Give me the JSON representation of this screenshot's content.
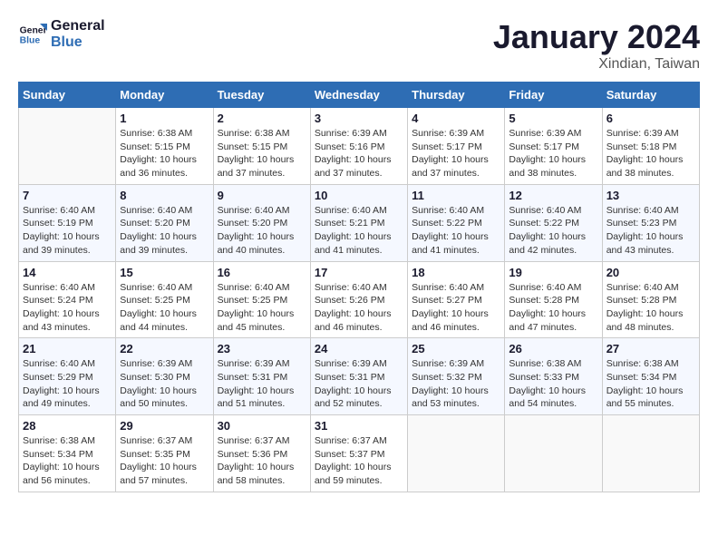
{
  "header": {
    "logo_line1": "General",
    "logo_line2": "Blue",
    "month_title": "January 2024",
    "location": "Xindian, Taiwan"
  },
  "weekdays": [
    "Sunday",
    "Monday",
    "Tuesday",
    "Wednesday",
    "Thursday",
    "Friday",
    "Saturday"
  ],
  "weeks": [
    [
      {
        "day": "",
        "sunrise": "",
        "sunset": "",
        "daylight": ""
      },
      {
        "day": "1",
        "sunrise": "Sunrise: 6:38 AM",
        "sunset": "Sunset: 5:15 PM",
        "daylight": "Daylight: 10 hours and 36 minutes."
      },
      {
        "day": "2",
        "sunrise": "Sunrise: 6:38 AM",
        "sunset": "Sunset: 5:15 PM",
        "daylight": "Daylight: 10 hours and 37 minutes."
      },
      {
        "day": "3",
        "sunrise": "Sunrise: 6:39 AM",
        "sunset": "Sunset: 5:16 PM",
        "daylight": "Daylight: 10 hours and 37 minutes."
      },
      {
        "day": "4",
        "sunrise": "Sunrise: 6:39 AM",
        "sunset": "Sunset: 5:17 PM",
        "daylight": "Daylight: 10 hours and 37 minutes."
      },
      {
        "day": "5",
        "sunrise": "Sunrise: 6:39 AM",
        "sunset": "Sunset: 5:17 PM",
        "daylight": "Daylight: 10 hours and 38 minutes."
      },
      {
        "day": "6",
        "sunrise": "Sunrise: 6:39 AM",
        "sunset": "Sunset: 5:18 PM",
        "daylight": "Daylight: 10 hours and 38 minutes."
      }
    ],
    [
      {
        "day": "7",
        "sunrise": "Sunrise: 6:40 AM",
        "sunset": "Sunset: 5:19 PM",
        "daylight": "Daylight: 10 hours and 39 minutes."
      },
      {
        "day": "8",
        "sunrise": "Sunrise: 6:40 AM",
        "sunset": "Sunset: 5:20 PM",
        "daylight": "Daylight: 10 hours and 39 minutes."
      },
      {
        "day": "9",
        "sunrise": "Sunrise: 6:40 AM",
        "sunset": "Sunset: 5:20 PM",
        "daylight": "Daylight: 10 hours and 40 minutes."
      },
      {
        "day": "10",
        "sunrise": "Sunrise: 6:40 AM",
        "sunset": "Sunset: 5:21 PM",
        "daylight": "Daylight: 10 hours and 41 minutes."
      },
      {
        "day": "11",
        "sunrise": "Sunrise: 6:40 AM",
        "sunset": "Sunset: 5:22 PM",
        "daylight": "Daylight: 10 hours and 41 minutes."
      },
      {
        "day": "12",
        "sunrise": "Sunrise: 6:40 AM",
        "sunset": "Sunset: 5:22 PM",
        "daylight": "Daylight: 10 hours and 42 minutes."
      },
      {
        "day": "13",
        "sunrise": "Sunrise: 6:40 AM",
        "sunset": "Sunset: 5:23 PM",
        "daylight": "Daylight: 10 hours and 43 minutes."
      }
    ],
    [
      {
        "day": "14",
        "sunrise": "Sunrise: 6:40 AM",
        "sunset": "Sunset: 5:24 PM",
        "daylight": "Daylight: 10 hours and 43 minutes."
      },
      {
        "day": "15",
        "sunrise": "Sunrise: 6:40 AM",
        "sunset": "Sunset: 5:25 PM",
        "daylight": "Daylight: 10 hours and 44 minutes."
      },
      {
        "day": "16",
        "sunrise": "Sunrise: 6:40 AM",
        "sunset": "Sunset: 5:25 PM",
        "daylight": "Daylight: 10 hours and 45 minutes."
      },
      {
        "day": "17",
        "sunrise": "Sunrise: 6:40 AM",
        "sunset": "Sunset: 5:26 PM",
        "daylight": "Daylight: 10 hours and 46 minutes."
      },
      {
        "day": "18",
        "sunrise": "Sunrise: 6:40 AM",
        "sunset": "Sunset: 5:27 PM",
        "daylight": "Daylight: 10 hours and 46 minutes."
      },
      {
        "day": "19",
        "sunrise": "Sunrise: 6:40 AM",
        "sunset": "Sunset: 5:28 PM",
        "daylight": "Daylight: 10 hours and 47 minutes."
      },
      {
        "day": "20",
        "sunrise": "Sunrise: 6:40 AM",
        "sunset": "Sunset: 5:28 PM",
        "daylight": "Daylight: 10 hours and 48 minutes."
      }
    ],
    [
      {
        "day": "21",
        "sunrise": "Sunrise: 6:40 AM",
        "sunset": "Sunset: 5:29 PM",
        "daylight": "Daylight: 10 hours and 49 minutes."
      },
      {
        "day": "22",
        "sunrise": "Sunrise: 6:39 AM",
        "sunset": "Sunset: 5:30 PM",
        "daylight": "Daylight: 10 hours and 50 minutes."
      },
      {
        "day": "23",
        "sunrise": "Sunrise: 6:39 AM",
        "sunset": "Sunset: 5:31 PM",
        "daylight": "Daylight: 10 hours and 51 minutes."
      },
      {
        "day": "24",
        "sunrise": "Sunrise: 6:39 AM",
        "sunset": "Sunset: 5:31 PM",
        "daylight": "Daylight: 10 hours and 52 minutes."
      },
      {
        "day": "25",
        "sunrise": "Sunrise: 6:39 AM",
        "sunset": "Sunset: 5:32 PM",
        "daylight": "Daylight: 10 hours and 53 minutes."
      },
      {
        "day": "26",
        "sunrise": "Sunrise: 6:38 AM",
        "sunset": "Sunset: 5:33 PM",
        "daylight": "Daylight: 10 hours and 54 minutes."
      },
      {
        "day": "27",
        "sunrise": "Sunrise: 6:38 AM",
        "sunset": "Sunset: 5:34 PM",
        "daylight": "Daylight: 10 hours and 55 minutes."
      }
    ],
    [
      {
        "day": "28",
        "sunrise": "Sunrise: 6:38 AM",
        "sunset": "Sunset: 5:34 PM",
        "daylight": "Daylight: 10 hours and 56 minutes."
      },
      {
        "day": "29",
        "sunrise": "Sunrise: 6:37 AM",
        "sunset": "Sunset: 5:35 PM",
        "daylight": "Daylight: 10 hours and 57 minutes."
      },
      {
        "day": "30",
        "sunrise": "Sunrise: 6:37 AM",
        "sunset": "Sunset: 5:36 PM",
        "daylight": "Daylight: 10 hours and 58 minutes."
      },
      {
        "day": "31",
        "sunrise": "Sunrise: 6:37 AM",
        "sunset": "Sunset: 5:37 PM",
        "daylight": "Daylight: 10 hours and 59 minutes."
      },
      {
        "day": "",
        "sunrise": "",
        "sunset": "",
        "daylight": ""
      },
      {
        "day": "",
        "sunrise": "",
        "sunset": "",
        "daylight": ""
      },
      {
        "day": "",
        "sunrise": "",
        "sunset": "",
        "daylight": ""
      }
    ]
  ]
}
